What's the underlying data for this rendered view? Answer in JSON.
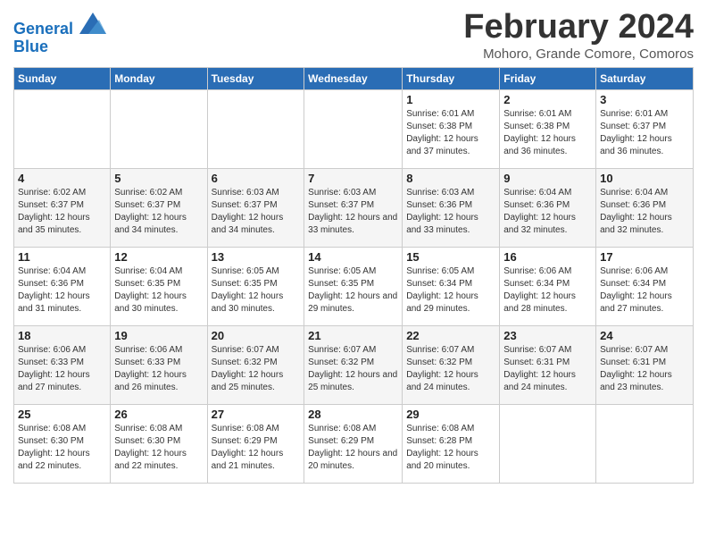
{
  "header": {
    "logo_line1": "General",
    "logo_line2": "Blue",
    "title": "February 2024",
    "subtitle": "Mohoro, Grande Comore, Comoros"
  },
  "days_of_week": [
    "Sunday",
    "Monday",
    "Tuesday",
    "Wednesday",
    "Thursday",
    "Friday",
    "Saturday"
  ],
  "weeks": [
    [
      {
        "day": "",
        "info": ""
      },
      {
        "day": "",
        "info": ""
      },
      {
        "day": "",
        "info": ""
      },
      {
        "day": "",
        "info": ""
      },
      {
        "day": "1",
        "info": "Sunrise: 6:01 AM\nSunset: 6:38 PM\nDaylight: 12 hours and 37 minutes."
      },
      {
        "day": "2",
        "info": "Sunrise: 6:01 AM\nSunset: 6:38 PM\nDaylight: 12 hours and 36 minutes."
      },
      {
        "day": "3",
        "info": "Sunrise: 6:01 AM\nSunset: 6:37 PM\nDaylight: 12 hours and 36 minutes."
      }
    ],
    [
      {
        "day": "4",
        "info": "Sunrise: 6:02 AM\nSunset: 6:37 PM\nDaylight: 12 hours and 35 minutes."
      },
      {
        "day": "5",
        "info": "Sunrise: 6:02 AM\nSunset: 6:37 PM\nDaylight: 12 hours and 34 minutes."
      },
      {
        "day": "6",
        "info": "Sunrise: 6:03 AM\nSunset: 6:37 PM\nDaylight: 12 hours and 34 minutes."
      },
      {
        "day": "7",
        "info": "Sunrise: 6:03 AM\nSunset: 6:37 PM\nDaylight: 12 hours and 33 minutes."
      },
      {
        "day": "8",
        "info": "Sunrise: 6:03 AM\nSunset: 6:36 PM\nDaylight: 12 hours and 33 minutes."
      },
      {
        "day": "9",
        "info": "Sunrise: 6:04 AM\nSunset: 6:36 PM\nDaylight: 12 hours and 32 minutes."
      },
      {
        "day": "10",
        "info": "Sunrise: 6:04 AM\nSunset: 6:36 PM\nDaylight: 12 hours and 32 minutes."
      }
    ],
    [
      {
        "day": "11",
        "info": "Sunrise: 6:04 AM\nSunset: 6:36 PM\nDaylight: 12 hours and 31 minutes."
      },
      {
        "day": "12",
        "info": "Sunrise: 6:04 AM\nSunset: 6:35 PM\nDaylight: 12 hours and 30 minutes."
      },
      {
        "day": "13",
        "info": "Sunrise: 6:05 AM\nSunset: 6:35 PM\nDaylight: 12 hours and 30 minutes."
      },
      {
        "day": "14",
        "info": "Sunrise: 6:05 AM\nSunset: 6:35 PM\nDaylight: 12 hours and 29 minutes."
      },
      {
        "day": "15",
        "info": "Sunrise: 6:05 AM\nSunset: 6:34 PM\nDaylight: 12 hours and 29 minutes."
      },
      {
        "day": "16",
        "info": "Sunrise: 6:06 AM\nSunset: 6:34 PM\nDaylight: 12 hours and 28 minutes."
      },
      {
        "day": "17",
        "info": "Sunrise: 6:06 AM\nSunset: 6:34 PM\nDaylight: 12 hours and 27 minutes."
      }
    ],
    [
      {
        "day": "18",
        "info": "Sunrise: 6:06 AM\nSunset: 6:33 PM\nDaylight: 12 hours and 27 minutes."
      },
      {
        "day": "19",
        "info": "Sunrise: 6:06 AM\nSunset: 6:33 PM\nDaylight: 12 hours and 26 minutes."
      },
      {
        "day": "20",
        "info": "Sunrise: 6:07 AM\nSunset: 6:32 PM\nDaylight: 12 hours and 25 minutes."
      },
      {
        "day": "21",
        "info": "Sunrise: 6:07 AM\nSunset: 6:32 PM\nDaylight: 12 hours and 25 minutes."
      },
      {
        "day": "22",
        "info": "Sunrise: 6:07 AM\nSunset: 6:32 PM\nDaylight: 12 hours and 24 minutes."
      },
      {
        "day": "23",
        "info": "Sunrise: 6:07 AM\nSunset: 6:31 PM\nDaylight: 12 hours and 24 minutes."
      },
      {
        "day": "24",
        "info": "Sunrise: 6:07 AM\nSunset: 6:31 PM\nDaylight: 12 hours and 23 minutes."
      }
    ],
    [
      {
        "day": "25",
        "info": "Sunrise: 6:08 AM\nSunset: 6:30 PM\nDaylight: 12 hours and 22 minutes."
      },
      {
        "day": "26",
        "info": "Sunrise: 6:08 AM\nSunset: 6:30 PM\nDaylight: 12 hours and 22 minutes."
      },
      {
        "day": "27",
        "info": "Sunrise: 6:08 AM\nSunset: 6:29 PM\nDaylight: 12 hours and 21 minutes."
      },
      {
        "day": "28",
        "info": "Sunrise: 6:08 AM\nSunset: 6:29 PM\nDaylight: 12 hours and 20 minutes."
      },
      {
        "day": "29",
        "info": "Sunrise: 6:08 AM\nSunset: 6:28 PM\nDaylight: 12 hours and 20 minutes."
      },
      {
        "day": "",
        "info": ""
      },
      {
        "day": "",
        "info": ""
      }
    ]
  ]
}
